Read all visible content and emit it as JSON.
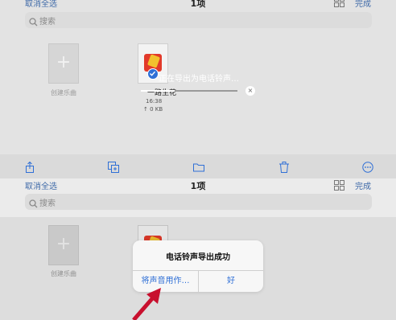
{
  "top": {
    "nav": {
      "cancel_select_all": "取消全选",
      "title": "1项",
      "done": "完成"
    },
    "search": {
      "placeholder": "搜索"
    },
    "create_song": {
      "label": "创建乐曲"
    },
    "file": {
      "name": "一路生花",
      "time": "16:38",
      "size": "↑ 0 KB",
      "selected": true
    },
    "export": {
      "text": "正在导出为电话铃声…",
      "progress": 0.35,
      "cancel_icon": "×"
    },
    "toolbar": [
      "share-icon",
      "duplicate-icon",
      "folder-icon",
      "trash-icon",
      "more-icon"
    ]
  },
  "bottom": {
    "nav": {
      "cancel_select_all": "取消全选",
      "title": "1项",
      "done": "完成"
    },
    "search": {
      "placeholder": "搜索"
    },
    "create_song": {
      "label": "创建乐曲"
    },
    "alert": {
      "title": "电话铃声导出成功",
      "use_sound_as": "将声音用作…",
      "ok": "好"
    }
  },
  "colors": {
    "accent": "#2f6fd6",
    "annotation_arrow": "#c8102e"
  }
}
